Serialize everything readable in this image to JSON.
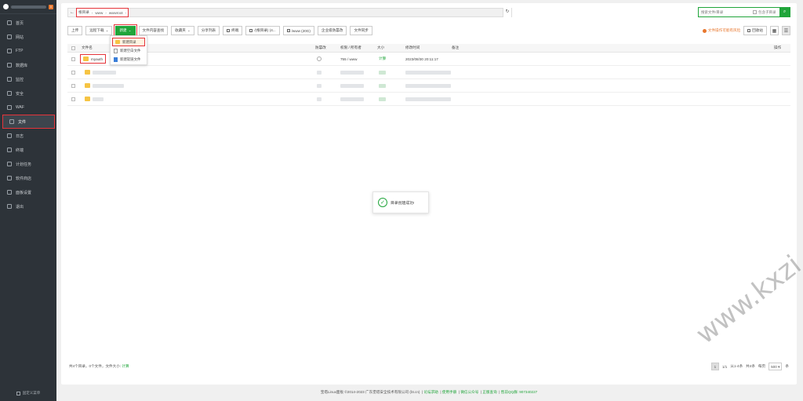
{
  "sidebar": {
    "badge": "0",
    "items": [
      {
        "label": "首页",
        "icon": "home-icon"
      },
      {
        "label": "网站",
        "icon": "globe-icon"
      },
      {
        "label": "FTP",
        "icon": "ftp-icon"
      },
      {
        "label": "数据库",
        "icon": "database-icon"
      },
      {
        "label": "监控",
        "icon": "monitor-icon"
      },
      {
        "label": "安全",
        "icon": "shield-icon"
      },
      {
        "label": "WAF",
        "icon": "waf-icon"
      },
      {
        "label": "文件",
        "icon": "folder-icon",
        "active": true
      },
      {
        "label": "日志",
        "icon": "log-icon"
      },
      {
        "label": "终端",
        "icon": "terminal-icon"
      },
      {
        "label": "计划任务",
        "icon": "clock-icon"
      },
      {
        "label": "软件商店",
        "icon": "store-icon"
      },
      {
        "label": "面板设置",
        "icon": "gear-icon"
      },
      {
        "label": "退出",
        "icon": "logout-icon"
      }
    ],
    "bottom": "固定义菜单"
  },
  "address": {
    "crumbs": [
      "根目录",
      "www",
      "wwwroot"
    ]
  },
  "search": {
    "placeholder": "搜索文件/目录",
    "subdir_label": "包含子目录"
  },
  "toolbar": {
    "buttons": [
      "上传",
      "远程下载",
      "新建",
      "文件内容查找",
      "收藏夹",
      "分享列表",
      "终端",
      "/(根目录) (4...",
      "/www (20G)",
      "企业级防篡改",
      "文件同步"
    ],
    "warning": "文件操作可能有风险",
    "recycle": "回收站"
  },
  "dropdown": {
    "items": [
      "新建目录",
      "新建空白文件",
      "新建软链文件"
    ]
  },
  "table": {
    "headers": {
      "name": "文件名",
      "protect": "防篡改",
      "perm": "权限 / 所有者",
      "size": "大小",
      "mtime": "修改时间",
      "remark": "备注",
      "ops": "操作"
    },
    "first_row": {
      "name": "myauth",
      "perm": "755 / www",
      "size": "计算",
      "mtime": "2023/08/30 20:11:17"
    }
  },
  "toast": {
    "message": "目录创建成功!"
  },
  "summary": {
    "text": "共4个目录，0个文件，文件大小:",
    "calc": "计算"
  },
  "pager": {
    "current": "1",
    "of": "1/1",
    "prev": "从1-4条",
    "count": "共4条",
    "per_label": "每页",
    "per_value": "500",
    "dropdown_arrow": "▾"
  },
  "copyright": {
    "text": "宝塔Linux面板 ©2014-2023 广东堡塔安全技术有限公司 (bt.cn)",
    "links": [
      "论坛求助",
      "使用手册",
      "微信公众号",
      "正版查询",
      "售前QQ群: 907340227"
    ]
  },
  "watermark": "www.kxzi.cn"
}
